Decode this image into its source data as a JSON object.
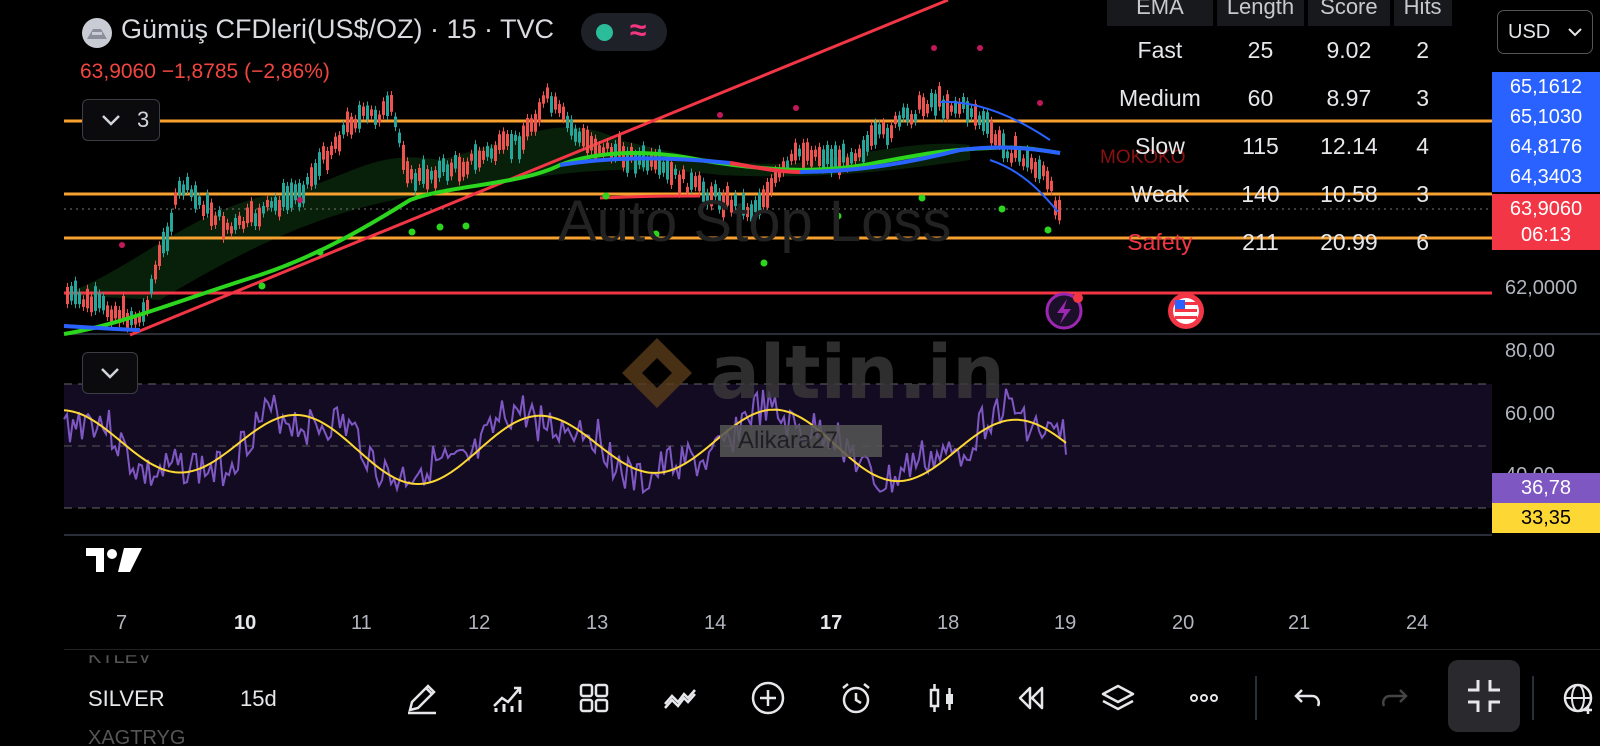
{
  "header": {
    "symbol_title": "Gümüş CFDleri(US$/OZ) · 15 · TVC",
    "price_change": "63,9060  −1,8785 (−2,86%)",
    "collapsed_count": "3"
  },
  "indicator_table": {
    "headers": [
      "EMA",
      "Length",
      "Score",
      "Hits"
    ],
    "rows": [
      {
        "name": "Fast",
        "length": "25",
        "score": "9.02",
        "hits": "2",
        "name_color": "#e6e7ea"
      },
      {
        "name": "Medium",
        "length": "60",
        "score": "8.97",
        "hits": "3",
        "name_color": "#e6e7ea"
      },
      {
        "name": "Slow",
        "length": "115",
        "score": "12.14",
        "hits": "4",
        "name_color": "#e6e7ea"
      },
      {
        "name": "Weak",
        "length": "140",
        "score": "10.58",
        "hits": "3",
        "name_color": "#e6e7ea"
      },
      {
        "name": "Safety",
        "length": "211",
        "score": "20.99",
        "hits": "6",
        "name_color": "#f23645"
      }
    ]
  },
  "chart_overlays": {
    "mokoko_label": "MOKOKO",
    "watermark_text": "Auto Stop Loss",
    "brand_watermark": "altin.in",
    "author_tag": "Alikara27"
  },
  "price_axis": {
    "currency": "USD",
    "tags": [
      {
        "label": "65,1612",
        "color": "#2962ff"
      },
      {
        "label": "65,1030",
        "color": "#2962ff"
      },
      {
        "label": "64,8176",
        "color": "#2962ff"
      },
      {
        "label": "64,3403",
        "color": "#2962ff"
      },
      {
        "label": "63,9060",
        "color": "#f23645"
      }
    ],
    "countdown": "06:13",
    "level_62": "62,0000"
  },
  "rsi_axis": {
    "labels": [
      "80,00",
      "60,00",
      "40,00"
    ],
    "rsi_value": "36,78",
    "rsi_ma_value": "33,35"
  },
  "time_axis": [
    "7",
    "10",
    "11",
    "12",
    "13",
    "14",
    "17",
    "18",
    "19",
    "20",
    "21",
    "24"
  ],
  "bottom_bar": {
    "ticker_top": "KTLEV",
    "ticker": "SILVER",
    "interval": "15d",
    "ticker_bottom": "XAGTRYG"
  },
  "icons": [
    "drawing-pen-icon",
    "indicators-icon",
    "layouts-grid-icon",
    "trendline-icon",
    "add-icon",
    "alarm-icon",
    "candles-icon",
    "replay-icon",
    "layers-icon",
    "more-icon",
    "undo-icon",
    "redo-icon",
    "fullscreen-exit-icon",
    "globe-add-icon"
  ],
  "colors": {
    "support_line": "#f7a130",
    "trend_line": "#f23645",
    "ema_green": "#2dd61e",
    "ema_blue": "#2962ff",
    "rsi_line": "#7e57c2",
    "rsi_ma": "#fdd835"
  }
}
